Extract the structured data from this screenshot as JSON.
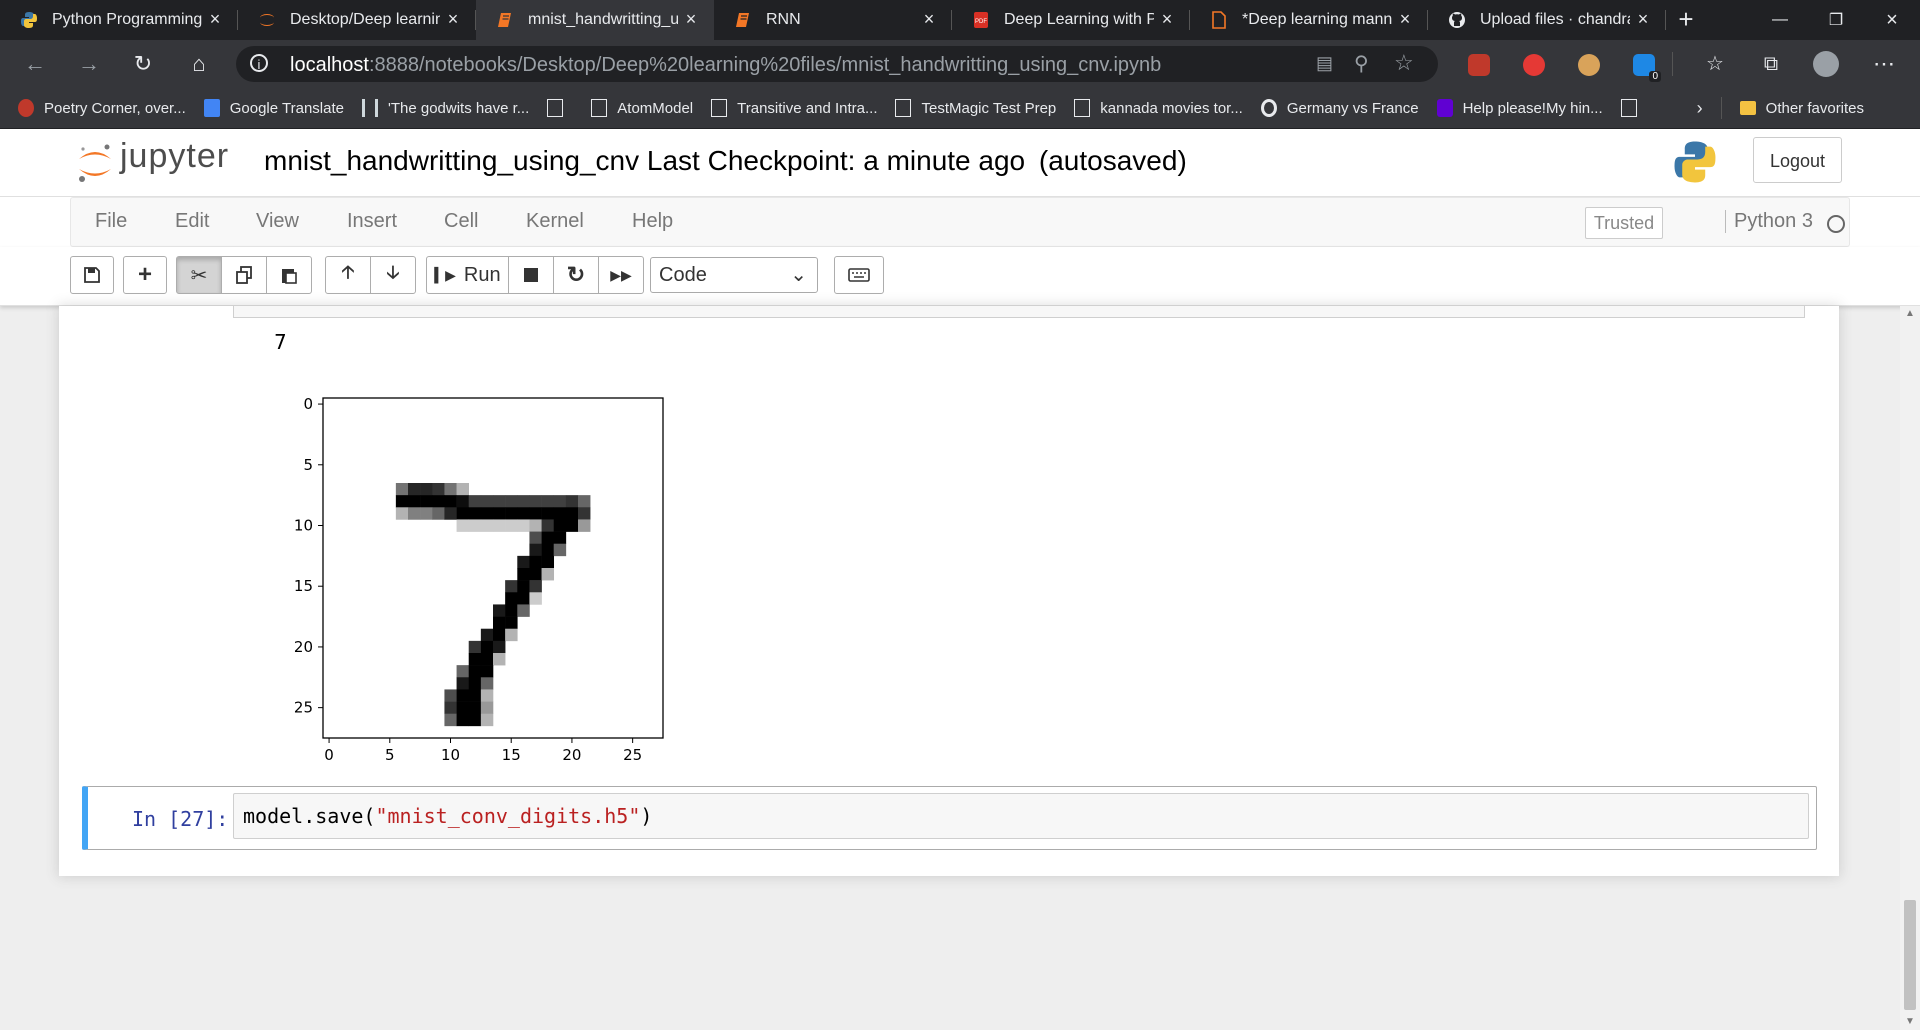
{
  "browser": {
    "tabs": [
      {
        "title": "Python Programming T",
        "icon": "python-icon"
      },
      {
        "title": "Desktop/Deep learning",
        "icon": "jupyter-icon"
      },
      {
        "title": "mnist_handwritting_us",
        "icon": "notebook-icon",
        "active": true
      },
      {
        "title": "RNN",
        "icon": "notebook-icon"
      },
      {
        "title": "Deep Learning with Py",
        "icon": "pdf-icon"
      },
      {
        "title": "*Deep learning mannin",
        "icon": "document-icon"
      },
      {
        "title": "Upload files · chandrad",
        "icon": "github-icon"
      }
    ],
    "url_host": "localhost",
    "url_path": ":8888/notebooks/Desktop/Deep%20learning%20files/mnist_handwritting_using_cnv.ipynb",
    "extension_badge": "0",
    "bookmarks": [
      "Poetry Corner, over...",
      "Google Translate",
      "'The godwits have r...",
      "",
      "AtomModel",
      "Transitive and Intra...",
      "TestMagic Test Prep",
      "kannada movies tor...",
      "Germany vs France",
      "Help please!My hin..."
    ],
    "other_favorites": "Other favorites"
  },
  "jupyter": {
    "logo_text": "jupyter",
    "notebook_name": "mnist_handwritting_using_cnv",
    "checkpoint": "Last Checkpoint: a minute ago",
    "autosave": "(autosaved)",
    "logout": "Logout",
    "menu": [
      "File",
      "Edit",
      "View",
      "Insert",
      "Cell",
      "Kernel",
      "Help"
    ],
    "trusted": "Trusted",
    "kernel": "Python 3",
    "run_label": "Run",
    "cell_type": "Code"
  },
  "output": {
    "text": "7"
  },
  "cell": {
    "prompt": "In [27]:",
    "code_fn": "model.save(",
    "code_str": "\"mnist_conv_digits.h5\"",
    "code_close": ")"
  },
  "chart_data": {
    "type": "heatmap",
    "title": "",
    "colormap": "gray_r",
    "x_ticks": [
      0,
      5,
      10,
      15,
      20,
      25
    ],
    "y_ticks": [
      0,
      5,
      10,
      15,
      20,
      25
    ],
    "xlim": [
      -0.5,
      27.5
    ],
    "ylim": [
      27.5,
      -0.5
    ],
    "grid": false,
    "size": [
      28,
      28
    ],
    "pixels": [
      [
        6,
        7,
        0.55
      ],
      [
        7,
        7,
        0.85
      ],
      [
        8,
        7,
        0.85
      ],
      [
        9,
        7,
        0.8
      ],
      [
        10,
        7,
        0.55
      ],
      [
        11,
        7,
        0.3
      ],
      [
        6,
        8,
        1
      ],
      [
        7,
        8,
        1
      ],
      [
        8,
        8,
        1
      ],
      [
        9,
        8,
        1
      ],
      [
        10,
        8,
        1
      ],
      [
        11,
        8,
        0.95
      ],
      [
        12,
        8,
        0.75
      ],
      [
        13,
        8,
        0.75
      ],
      [
        14,
        8,
        0.75
      ],
      [
        15,
        8,
        0.75
      ],
      [
        16,
        8,
        0.75
      ],
      [
        17,
        8,
        0.75
      ],
      [
        18,
        8,
        0.75
      ],
      [
        19,
        8,
        0.75
      ],
      [
        20,
        8,
        0.8
      ],
      [
        21,
        8,
        0.6
      ],
      [
        6,
        9,
        0.3
      ],
      [
        7,
        9,
        0.5
      ],
      [
        8,
        9,
        0.5
      ],
      [
        9,
        9,
        0.6
      ],
      [
        10,
        9,
        0.85
      ],
      [
        11,
        9,
        1
      ],
      [
        12,
        9,
        1
      ],
      [
        13,
        9,
        1
      ],
      [
        14,
        9,
        1
      ],
      [
        15,
        9,
        1
      ],
      [
        16,
        9,
        1
      ],
      [
        17,
        9,
        1
      ],
      [
        18,
        9,
        1
      ],
      [
        19,
        9,
        1
      ],
      [
        20,
        9,
        1
      ],
      [
        21,
        9,
        0.8
      ],
      [
        11,
        10,
        0.2
      ],
      [
        12,
        10,
        0.2
      ],
      [
        13,
        10,
        0.2
      ],
      [
        14,
        10,
        0.2
      ],
      [
        15,
        10,
        0.2
      ],
      [
        16,
        10,
        0.2
      ],
      [
        17,
        10,
        0.3
      ],
      [
        18,
        10,
        0.8
      ],
      [
        19,
        10,
        1
      ],
      [
        20,
        10,
        1
      ],
      [
        21,
        10,
        0.4
      ],
      [
        17,
        11,
        0.7
      ],
      [
        18,
        11,
        1
      ],
      [
        19,
        11,
        1
      ],
      [
        17,
        12,
        0.9
      ],
      [
        18,
        12,
        1
      ],
      [
        19,
        12,
        0.6
      ],
      [
        16,
        13,
        0.9
      ],
      [
        17,
        13,
        1
      ],
      [
        18,
        13,
        1
      ],
      [
        16,
        14,
        1
      ],
      [
        17,
        14,
        1
      ],
      [
        18,
        14,
        0.3
      ],
      [
        15,
        15,
        0.8
      ],
      [
        16,
        15,
        1
      ],
      [
        17,
        15,
        0.8
      ],
      [
        15,
        16,
        1
      ],
      [
        16,
        16,
        1
      ],
      [
        17,
        16,
        0.2
      ],
      [
        14,
        17,
        0.9
      ],
      [
        15,
        17,
        1
      ],
      [
        16,
        17,
        0.6
      ],
      [
        14,
        18,
        1
      ],
      [
        15,
        18,
        1
      ],
      [
        13,
        19,
        0.9
      ],
      [
        14,
        19,
        1
      ],
      [
        15,
        19,
        0.3
      ],
      [
        12,
        20,
        0.8
      ],
      [
        13,
        20,
        1
      ],
      [
        14,
        20,
        0.9
      ],
      [
        12,
        21,
        1
      ],
      [
        13,
        21,
        1
      ],
      [
        14,
        21,
        0.3
      ],
      [
        11,
        22,
        0.6
      ],
      [
        12,
        22,
        1
      ],
      [
        13,
        22,
        1
      ],
      [
        11,
        23,
        0.9
      ],
      [
        12,
        23,
        1
      ],
      [
        13,
        23,
        0.6
      ],
      [
        10,
        24,
        0.7
      ],
      [
        11,
        24,
        1
      ],
      [
        12,
        24,
        1
      ],
      [
        13,
        24,
        0.3
      ],
      [
        10,
        25,
        0.8
      ],
      [
        11,
        25,
        1
      ],
      [
        12,
        25,
        1
      ],
      [
        13,
        25,
        0.4
      ],
      [
        10,
        26,
        0.6
      ],
      [
        11,
        26,
        1
      ],
      [
        12,
        26,
        1
      ],
      [
        13,
        26,
        0.3
      ]
    ]
  }
}
